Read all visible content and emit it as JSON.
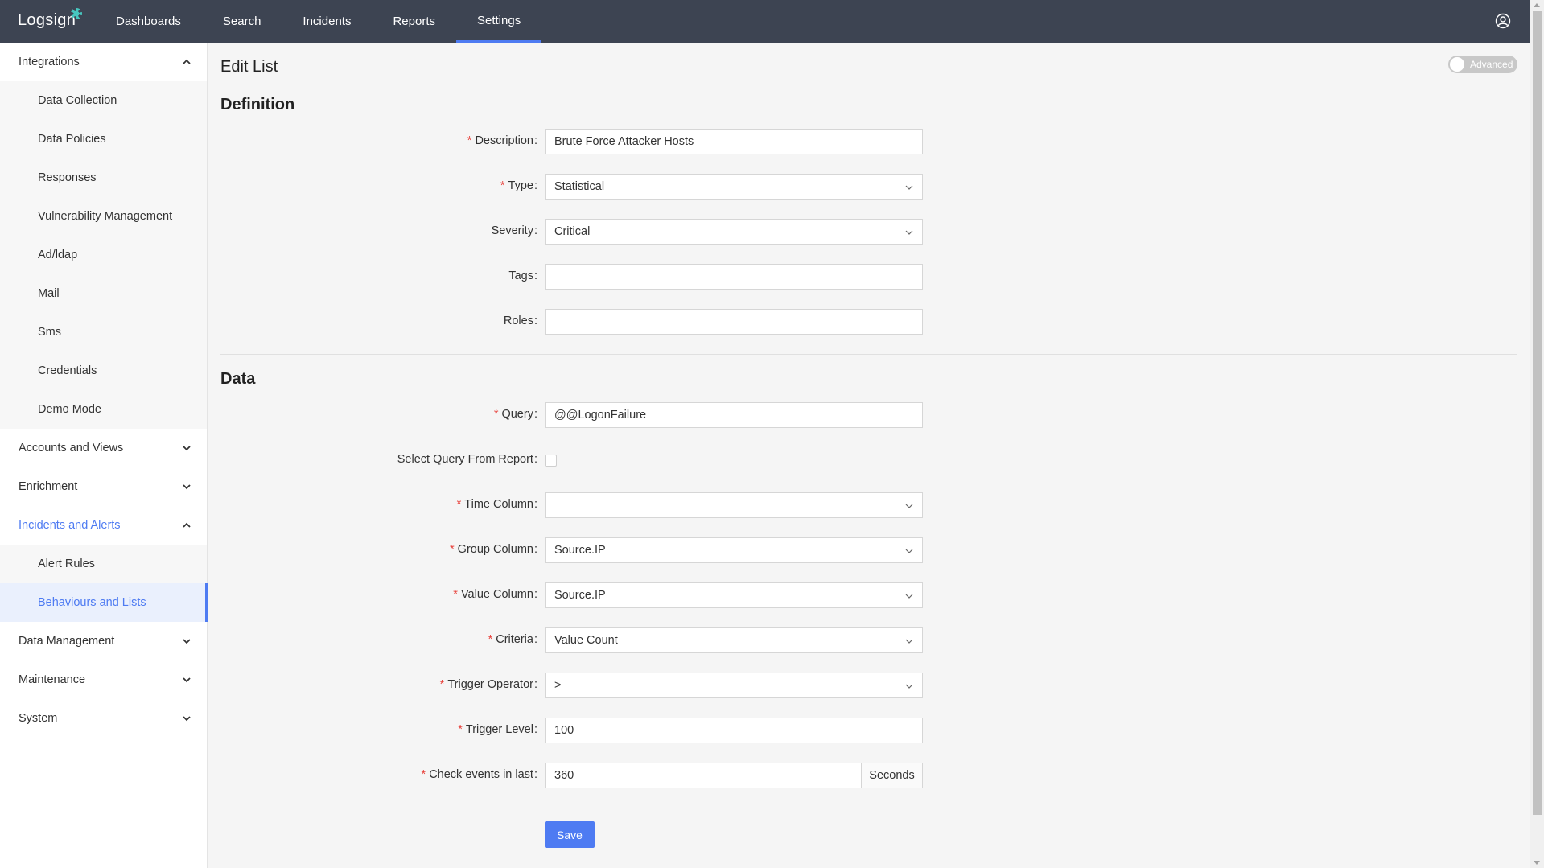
{
  "app": {
    "logo": "Logsign"
  },
  "nav": {
    "items": [
      "Dashboards",
      "Search",
      "Incidents",
      "Reports",
      "Settings"
    ],
    "active": "Settings"
  },
  "sidebar": {
    "integrations": {
      "label": "Integrations",
      "items": [
        "Data Collection",
        "Data Policies",
        "Responses",
        "Vulnerability Management",
        "Ad/ldap",
        "Mail",
        "Sms",
        "Credentials",
        "Demo Mode"
      ]
    },
    "accounts": {
      "label": "Accounts and Views"
    },
    "enrichment": {
      "label": "Enrichment"
    },
    "incidents": {
      "label": "Incidents and Alerts",
      "items": [
        "Alert Rules",
        "Behaviours and Lists"
      ],
      "active_item": "Behaviours and Lists"
    },
    "data_management": {
      "label": "Data Management"
    },
    "maintenance": {
      "label": "Maintenance"
    },
    "system": {
      "label": "System"
    }
  },
  "page": {
    "title": "Edit List",
    "advanced_label": "Advanced",
    "advanced_on": false
  },
  "definition": {
    "title": "Definition",
    "description": {
      "label": "Description",
      "value": "Brute Force Attacker Hosts",
      "required": true
    },
    "type": {
      "label": "Type",
      "value": "Statistical",
      "required": true
    },
    "severity": {
      "label": "Severity",
      "value": "Critical",
      "required": false
    },
    "tags": {
      "label": "Tags",
      "value": "",
      "required": false
    },
    "roles": {
      "label": "Roles",
      "value": "",
      "required": false
    }
  },
  "data_section": {
    "title": "Data",
    "query": {
      "label": "Query",
      "value": "@@LogonFailure",
      "required": true
    },
    "select_query": {
      "label": "Select Query From Report",
      "checked": false
    },
    "time_column": {
      "label": "Time Column",
      "value": "",
      "required": true
    },
    "group_column": {
      "label": "Group Column",
      "value": "Source.IP",
      "required": true
    },
    "value_column": {
      "label": "Value Column",
      "value": "Source.IP",
      "required": true
    },
    "criteria": {
      "label": "Criteria",
      "value": "Value Count",
      "required": true
    },
    "trigger_operator": {
      "label": "Trigger Operator",
      "value": ">",
      "required": true
    },
    "trigger_level": {
      "label": "Trigger Level",
      "value": "100",
      "required": true
    },
    "check_events": {
      "label": "Check events in last",
      "value": "360",
      "unit": "Seconds",
      "required": true
    }
  },
  "actions": {
    "save": "Save"
  },
  "colors": {
    "accent": "#4e7bf2",
    "topbar": "#3d4452",
    "required": "#e8413b"
  }
}
